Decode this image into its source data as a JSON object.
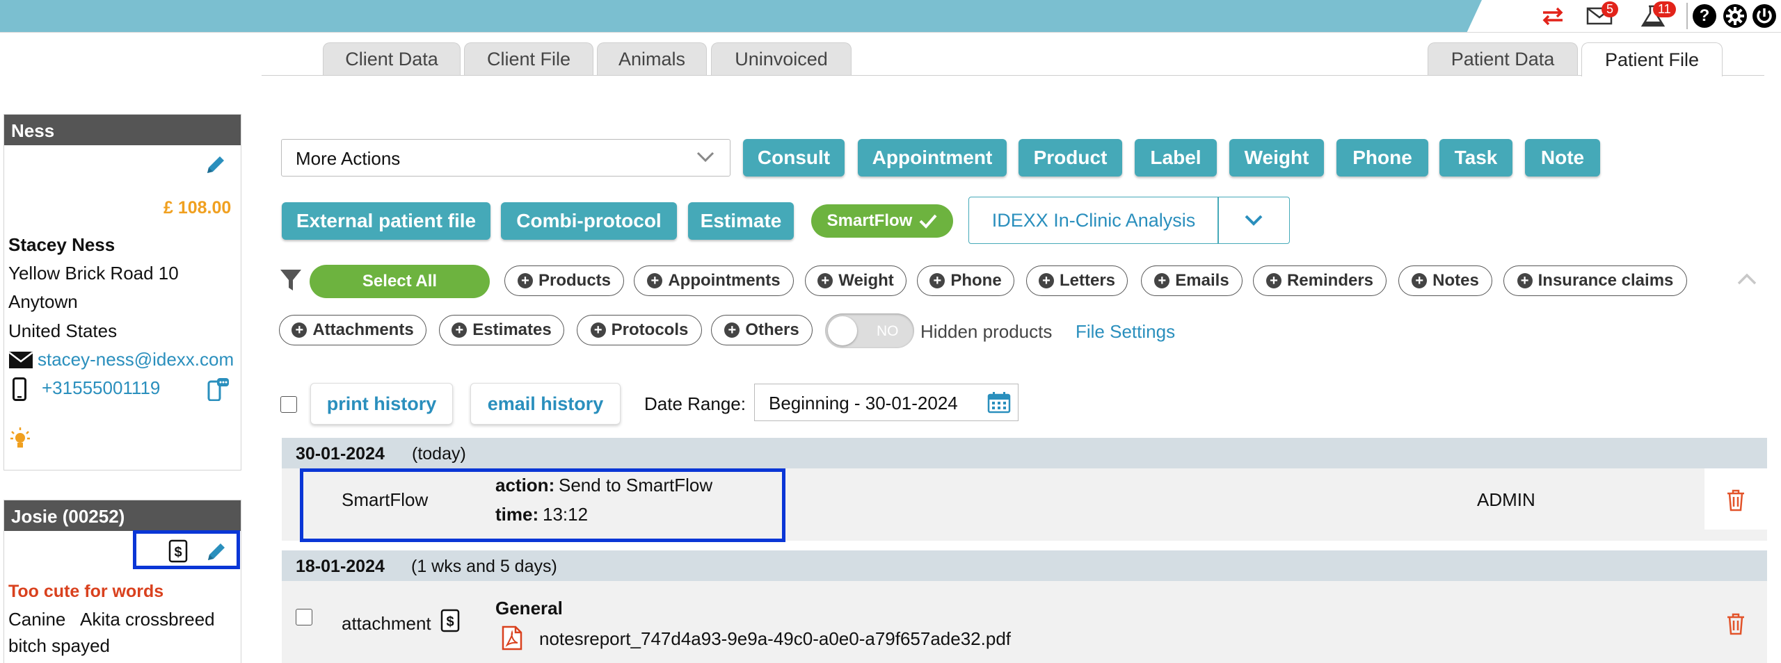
{
  "topbar": {
    "mail_count": "5",
    "lab_count": "11",
    "help_glyph": "?",
    "icons": [
      "transfer-arrows-icon",
      "mail-icon",
      "lab-flask-icon",
      "help-icon",
      "gear-icon",
      "power-icon"
    ]
  },
  "tabs_left": [
    "Client Data",
    "Client File",
    "Animals",
    "Uninvoiced"
  ],
  "tabs_right": [
    "Patient Data",
    "Patient File"
  ],
  "client": {
    "header": "Ness",
    "balance": "£ 108.00",
    "name": "Stacey Ness",
    "address1": "Yellow Brick Road 10",
    "city": "Anytown",
    "country": "United States",
    "email": "stacey-ness@idexx.com",
    "phone": "+31555001119"
  },
  "patient": {
    "header": "Josie (00252)",
    "note": "Too cute for words",
    "species": "Canine",
    "breed": "Akita crossbreed",
    "sex": "bitch spayed"
  },
  "actions": {
    "more_actions": "More Actions",
    "row1": [
      "Consult",
      "Appointment",
      "Product",
      "Label",
      "Weight",
      "Phone",
      "Task",
      "Note"
    ],
    "row2": [
      "External patient file",
      "Combi-protocol",
      "Estimate"
    ],
    "smartflow": "SmartFlow",
    "idexx": "IDEXX In-Clinic Analysis"
  },
  "filters": {
    "select_all": "Select All",
    "chips_row1": [
      "Products",
      "Appointments",
      "Weight",
      "Phone",
      "Letters",
      "Emails",
      "Reminders",
      "Notes",
      "Insurance claims"
    ],
    "chips_row2": [
      "Attachments",
      "Estimates",
      "Protocols",
      "Others"
    ],
    "toggle_value": "NO",
    "hidden_products": "Hidden products",
    "file_settings": "File Settings"
  },
  "history": {
    "print": "print history",
    "email": "email history",
    "date_range_label": "Date Range:",
    "date_range_value": "Beginning - 30-01-2024"
  },
  "entries": [
    {
      "date": "30-01-2024",
      "relative": "(today)",
      "type": "SmartFlow",
      "action_label": "action:",
      "action_value": "Send to SmartFlow",
      "time_label": "time:",
      "time_value": "13:12",
      "user": "ADMIN"
    },
    {
      "date": "18-01-2024",
      "relative": "(1 wks and 5 days)",
      "type": "attachment",
      "title": "General",
      "file": "notesreport_747d4a93-9e9a-49c0-a0e0-a79f657ade32.pdf"
    }
  ],
  "colors": {
    "topband": "#7bbfd0",
    "teal_button": "#45a9b8",
    "smartflow_green": "#6db33f",
    "link_blue": "#2a8fbd",
    "balance_orange": "#f0a020",
    "alert_red": "#d9411e",
    "highlight_blue": "#0a36d6"
  }
}
